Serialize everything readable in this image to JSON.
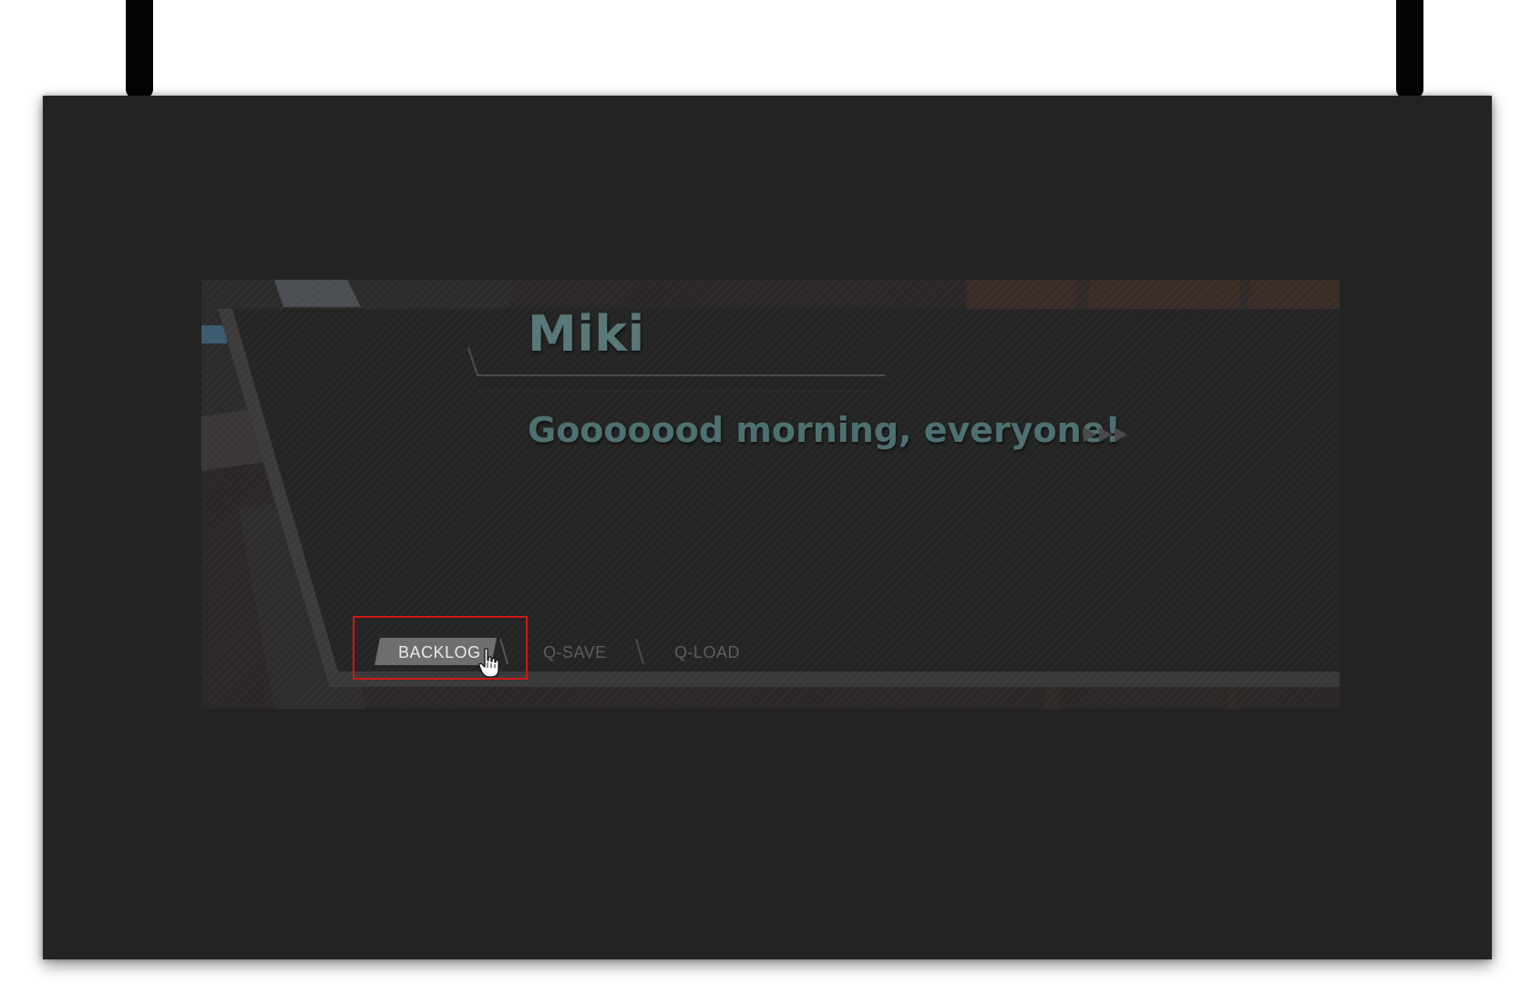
{
  "dialog": {
    "speaker": "Miki",
    "text": "Gooooood morning, everyone!"
  },
  "icons": {
    "advance": "fast-forward-triangles-icon",
    "cursor": "hand-pointer-icon"
  },
  "menu": {
    "backlog_label": "BACKLOG",
    "qsave_label": "Q-SAVE",
    "qload_label": "Q-LOAD",
    "focused": "BACKLOG"
  },
  "colors": {
    "board": "#232323",
    "speaker_text": "#5a7878",
    "dialogue_text": "#4f7070",
    "focus_highlight": "#d01818",
    "backlog_chip": "#6e6e6e"
  }
}
